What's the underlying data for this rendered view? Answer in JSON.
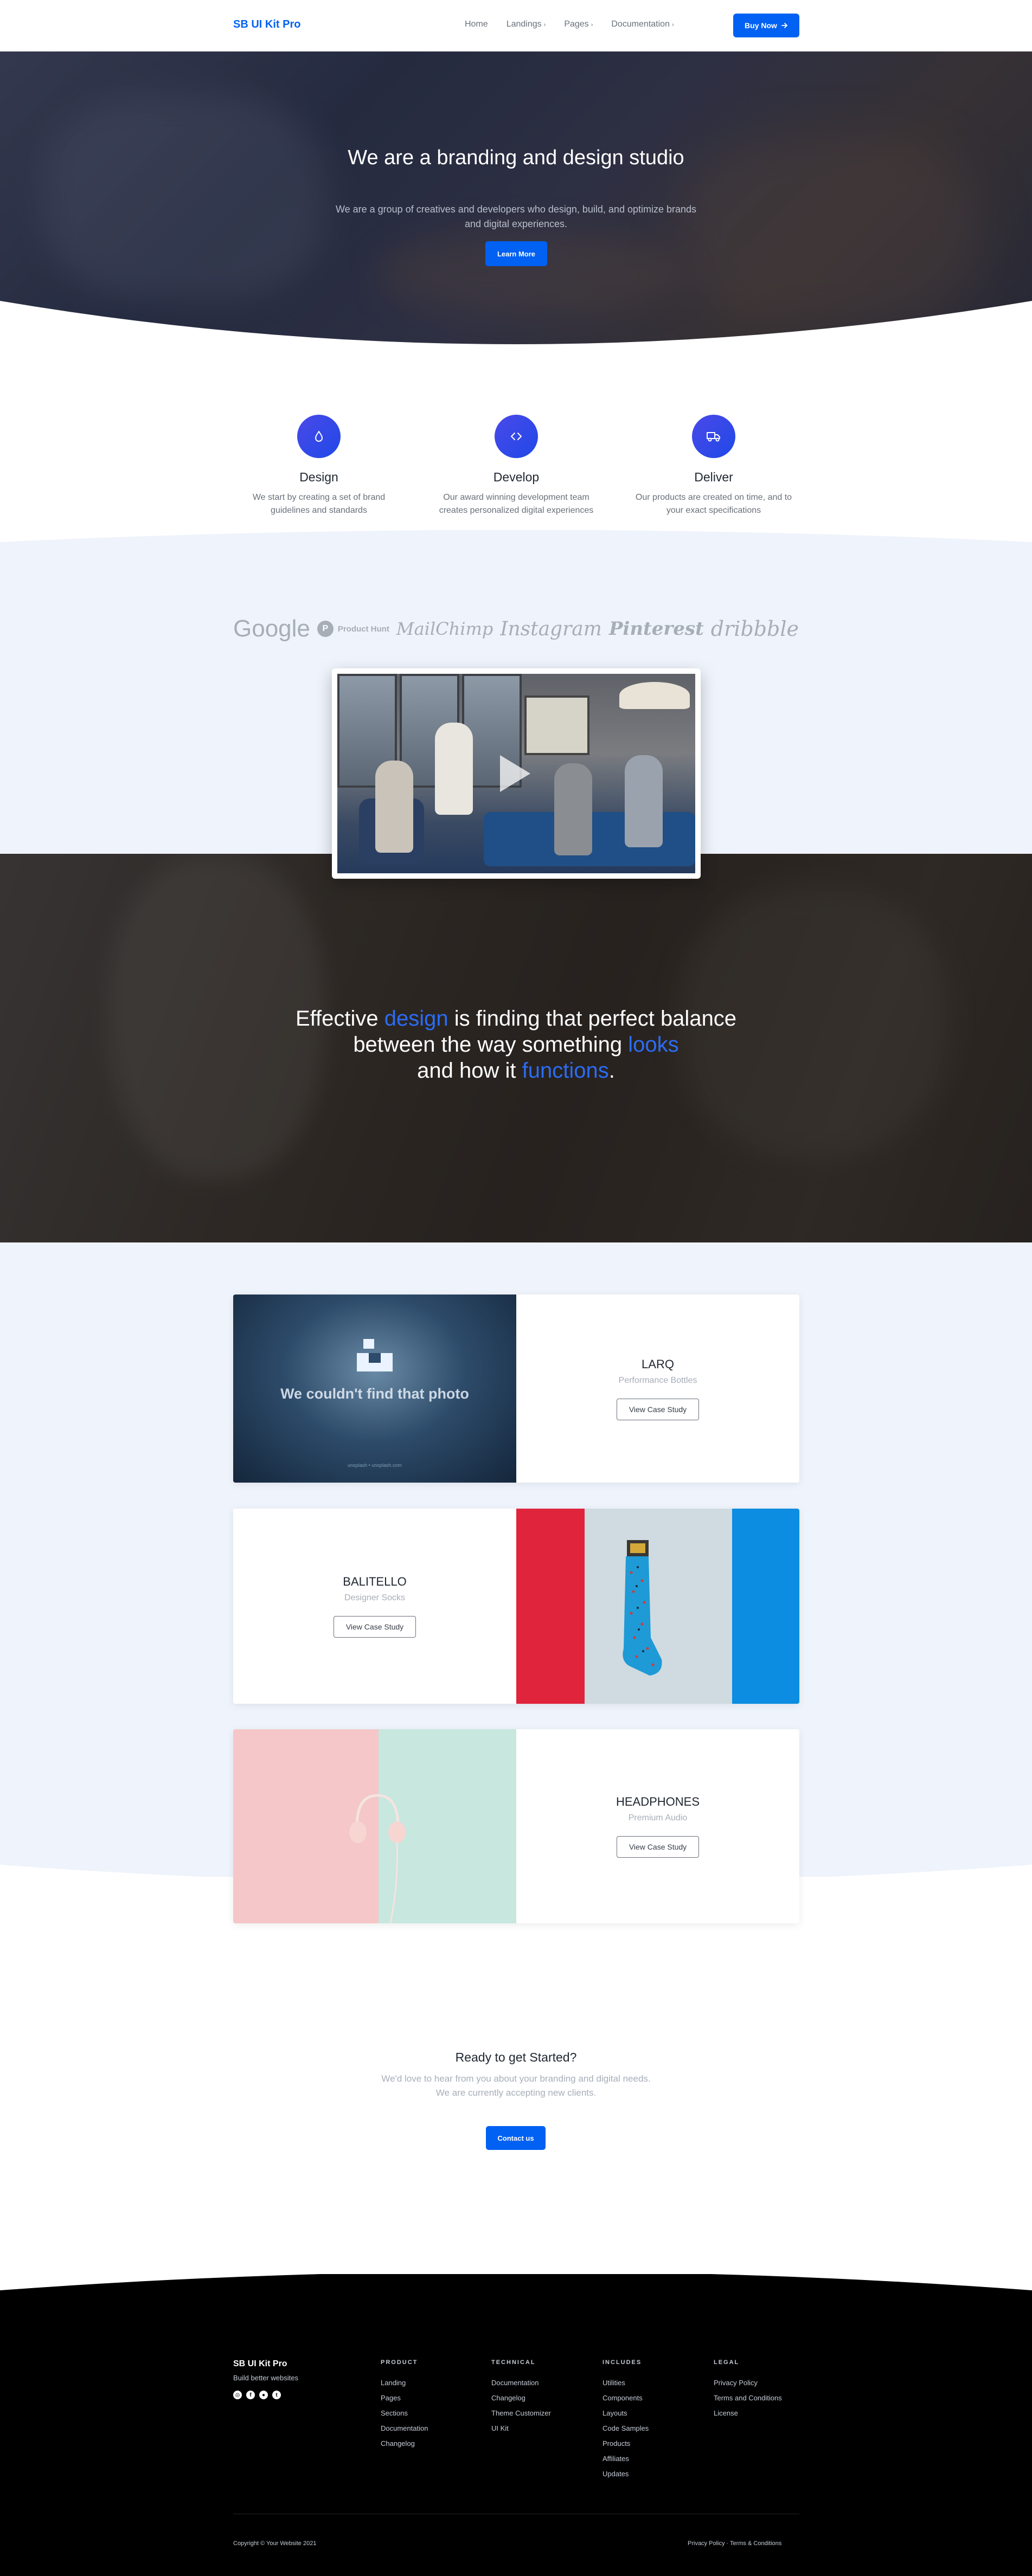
{
  "nav": {
    "brand": "SB UI Kit Pro",
    "links": [
      {
        "label": "Home",
        "has_caret": false
      },
      {
        "label": "Landings",
        "has_caret": true
      },
      {
        "label": "Pages",
        "has_caret": true
      },
      {
        "label": "Documentation",
        "has_caret": true
      }
    ],
    "caret_glyph": "›",
    "buy_label": "Buy Now",
    "buy_icon": "arrow-right-icon"
  },
  "hero": {
    "title": "We are a branding and design studio",
    "subtitle": "We are a group of creatives and developers who design, build, and optimize brands and digital experiences.",
    "button": "Learn More"
  },
  "features": [
    {
      "title": "Design",
      "text": "We start by creating a set of brand guidelines and standards",
      "icon": "droplet-icon"
    },
    {
      "title": "Develop",
      "text": "Our award winning development team creates personalized digital experiences",
      "icon": "code-icon"
    },
    {
      "title": "Deliver",
      "text": "Our products are created on time, and to your exact specifications",
      "icon": "truck-icon"
    }
  ],
  "logos": [
    "Google",
    "Product Hunt",
    "MailChimp",
    "Instagram",
    "Pinterest",
    "dribbble"
  ],
  "logo_ph_letter": "P",
  "quote": {
    "p1": "Effective ",
    "hl1": "design",
    "p2": " is finding that perfect balance between the way something ",
    "hl2": "looks",
    "p3": " and how it ",
    "hl3": "functions",
    "p4": ".",
    "highlight_color": "#2b6cf5"
  },
  "cases": [
    {
      "title": "LARQ",
      "subtitle": "Performance Bottles",
      "button": "View Case Study",
      "image_text": "We couldn't find that photo",
      "image_small": "unsplash • unsplash.com"
    },
    {
      "title": "BALITELLO",
      "subtitle": "Designer Socks",
      "button": "View Case Study"
    },
    {
      "title": "HEADPHONES",
      "subtitle": "Premium Audio",
      "button": "View Case Study"
    }
  ],
  "cta": {
    "title": "Ready to get Started?",
    "subtitle": "We'd love to hear from you about your branding and digital needs. We are currently accepting new clients.",
    "button": "Contact us"
  },
  "footer": {
    "brand": "SB UI Kit Pro",
    "tagline": "Build better websites",
    "social": [
      {
        "name": "instagram-icon",
        "glyph": "◎"
      },
      {
        "name": "facebook-icon",
        "glyph": "f"
      },
      {
        "name": "github-icon",
        "glyph": "●"
      },
      {
        "name": "twitter-icon",
        "glyph": "t"
      }
    ],
    "columns": [
      {
        "heading": "PRODUCT",
        "links": [
          "Landing",
          "Pages",
          "Sections",
          "Documentation",
          "Changelog"
        ]
      },
      {
        "heading": "TECHNICAL",
        "links": [
          "Documentation",
          "Changelog",
          "Theme Customizer",
          "UI Kit"
        ]
      },
      {
        "heading": "INCLUDES",
        "links": [
          "Utilities",
          "Components",
          "Layouts",
          "Code Samples",
          "Products",
          "Affiliates",
          "Updates"
        ]
      },
      {
        "heading": "LEGAL",
        "links": [
          "Privacy Policy",
          "Terms and Conditions",
          "License"
        ]
      }
    ],
    "copyright": "Copyright © Your Website 2021",
    "legal_line": "Privacy Policy · Terms & Conditions"
  },
  "colors": {
    "primary": "#0061f2",
    "light_band": "#eff3fb",
    "footer": "#000000"
  }
}
